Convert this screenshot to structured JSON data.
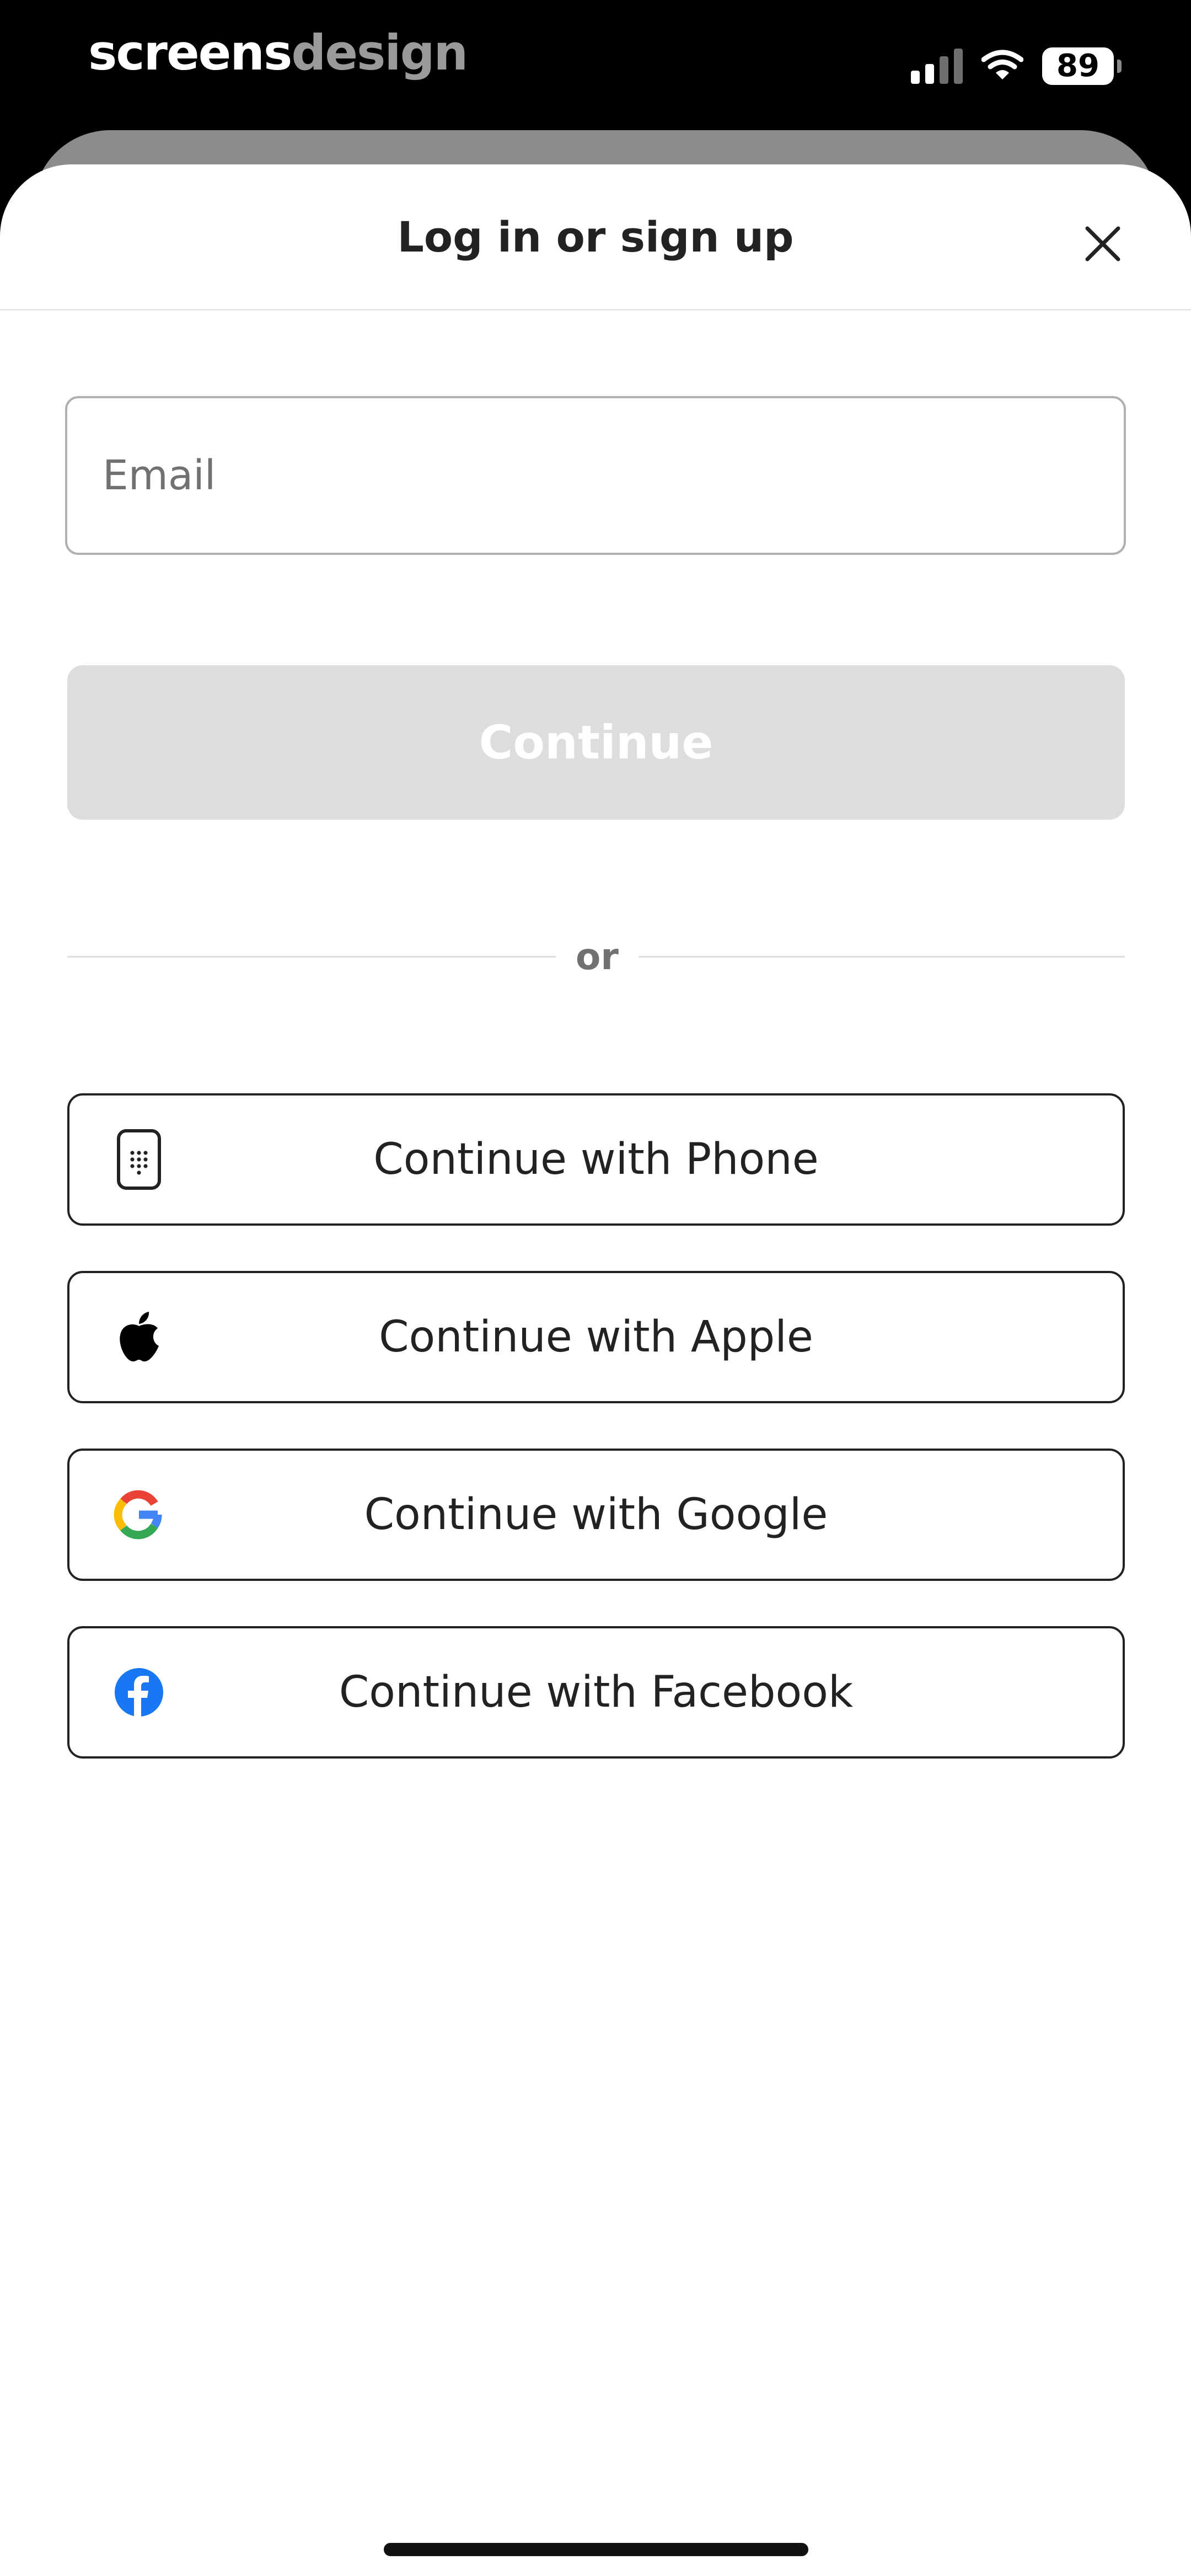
{
  "status_bar": {
    "watermark_part1": "screens",
    "watermark_part2": "design",
    "battery": "89"
  },
  "sheet": {
    "title": "Log in or sign up"
  },
  "email": {
    "value": "",
    "placeholder": "Email"
  },
  "continue_label": "Continue",
  "divider_label": "or",
  "auth_buttons": [
    {
      "label": "Continue with Phone",
      "icon": "phone-icon"
    },
    {
      "label": "Continue with Apple",
      "icon": "apple-icon"
    },
    {
      "label": "Continue with Google",
      "icon": "google-icon"
    },
    {
      "label": "Continue with Facebook",
      "icon": "facebook-icon"
    }
  ],
  "colors": {
    "primary_text": "#222222",
    "secondary_text": "#717171",
    "disabled_button": "#dddddd",
    "facebook_blue": "#1877F2"
  }
}
